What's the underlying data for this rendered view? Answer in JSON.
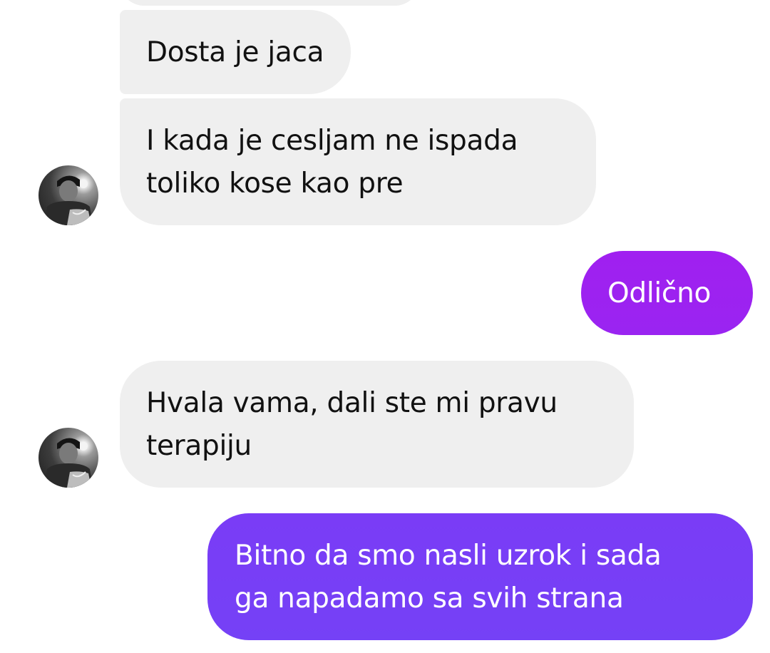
{
  "colors": {
    "incoming_bubble": "#efefef",
    "outgoing_gradient_top": "#a020f0",
    "outgoing_gradient_bottom": "#7a3cf6",
    "text_incoming": "#111111",
    "text_outgoing": "#ffffff"
  },
  "icons": {
    "avatar": "user-avatar-photo"
  },
  "messages": [
    {
      "direction": "incoming",
      "lines": [
        "Dosta je jaca"
      ]
    },
    {
      "direction": "incoming",
      "lines": [
        "I kada je cesljam ne ispada",
        "toliko kose kao pre"
      ]
    },
    {
      "direction": "outgoing",
      "lines": [
        "Odlično"
      ]
    },
    {
      "direction": "incoming",
      "lines": [
        "Hvala vama, dali ste mi pravu",
        "terapiju"
      ]
    },
    {
      "direction": "outgoing",
      "lines": [
        "Bitno da smo nasli uzrok i sada",
        "ga napadamo sa svih strana"
      ]
    }
  ]
}
